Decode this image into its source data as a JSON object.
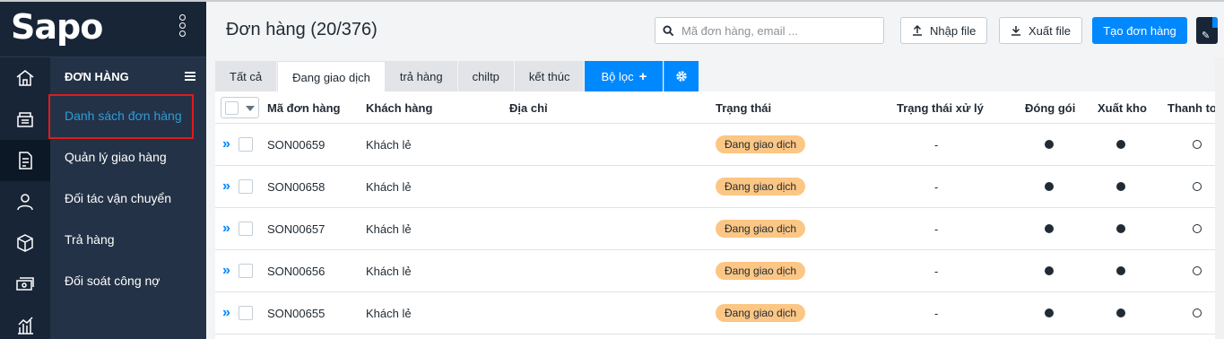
{
  "app": {
    "brand": "Sapo"
  },
  "rail": {
    "icons": [
      "home-icon",
      "store-icon",
      "order-doc-icon",
      "user-icon",
      "box-icon",
      "money-icon",
      "report-chart-icon"
    ]
  },
  "submenu": {
    "heading": "ĐƠN HÀNG",
    "items": [
      {
        "label": "Danh sách đơn hàng",
        "active": true
      },
      {
        "label": "Quản lý giao hàng"
      },
      {
        "label": "Đối tác vận chuyển"
      },
      {
        "label": "Trả hàng"
      },
      {
        "label": "Đối soát công nợ"
      }
    ]
  },
  "header": {
    "title": "Đơn hàng (20/376)",
    "search_placeholder": "Mã đơn hàng, email ...",
    "import_label": "Nhập file",
    "export_label": "Xuất file",
    "create_label": "Tạo đơn hàng"
  },
  "tabs": [
    {
      "label": "Tất cả"
    },
    {
      "label": "Đang giao dịch",
      "active": true
    },
    {
      "label": "trả hàng"
    },
    {
      "label": "chiltp"
    },
    {
      "label": "kết thúc"
    }
  ],
  "filter_label": "Bộ lọc",
  "table": {
    "columns": [
      "Mã đơn hàng",
      "Khách hàng",
      "Địa chỉ",
      "Trạng thái",
      "Trạng thái xử lý",
      "Đóng gói",
      "Xuất kho",
      "Thanh toán"
    ],
    "rows": [
      {
        "code": "SON00659",
        "customer": "Khách lẻ",
        "address": "",
        "status": "Đang giao dịch",
        "processing": "-",
        "packed": "filled",
        "exported": "filled",
        "paid": "empty"
      },
      {
        "code": "SON00658",
        "customer": "Khách lẻ",
        "address": "",
        "status": "Đang giao dịch",
        "processing": "-",
        "packed": "filled",
        "exported": "filled",
        "paid": "empty"
      },
      {
        "code": "SON00657",
        "customer": "Khách lẻ",
        "address": "",
        "status": "Đang giao dịch",
        "processing": "-",
        "packed": "filled",
        "exported": "filled",
        "paid": "empty"
      },
      {
        "code": "SON00656",
        "customer": "Khách lẻ",
        "address": "",
        "status": "Đang giao dịch",
        "processing": "-",
        "packed": "filled",
        "exported": "filled",
        "paid": "empty"
      },
      {
        "code": "SON00655",
        "customer": "Khách lẻ",
        "address": "",
        "status": "Đang giao dịch",
        "processing": "-",
        "packed": "filled",
        "exported": "filled",
        "paid": "empty"
      }
    ]
  },
  "colors": {
    "accent": "#0088ff",
    "sidebar": "#182537",
    "submenu": "#233246",
    "badge": "#fcc684",
    "highlight": "#e01b1b"
  }
}
